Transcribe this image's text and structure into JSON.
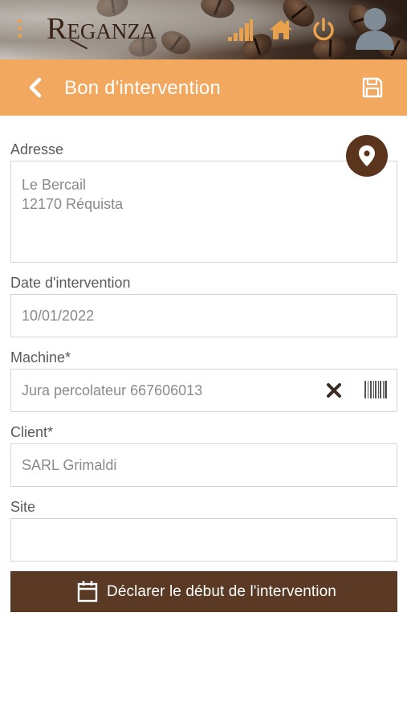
{
  "app": {
    "brand": "Reganza",
    "colors": {
      "accent": "#f2a85f",
      "brand_dark": "#5a341d",
      "button_dark": "#5a3a25",
      "icon_orange": "#e9a24b"
    }
  },
  "banner": {
    "icons": [
      "menu-dots-icon",
      "signal-bars-icon",
      "home-icon",
      "power-icon",
      "user-avatar-icon"
    ]
  },
  "header": {
    "title": "Bon d'intervention",
    "icons": [
      "chevron-left-icon",
      "floppy-disk-icon"
    ]
  },
  "form": {
    "address": {
      "label": "Adresse",
      "line1": "Le Bercail",
      "line2": "12170 Réquista"
    },
    "date": {
      "label": "Date d'intervention",
      "value": "10/01/2022"
    },
    "machine": {
      "label": "Machine*",
      "value": "Jura percolateur 667606013"
    },
    "client": {
      "label": "Client*",
      "value": "SARL Grimaldi"
    },
    "site": {
      "label": "Site",
      "value": ""
    }
  },
  "actions": {
    "start_label": "Déclarer le début de l'intervention"
  }
}
